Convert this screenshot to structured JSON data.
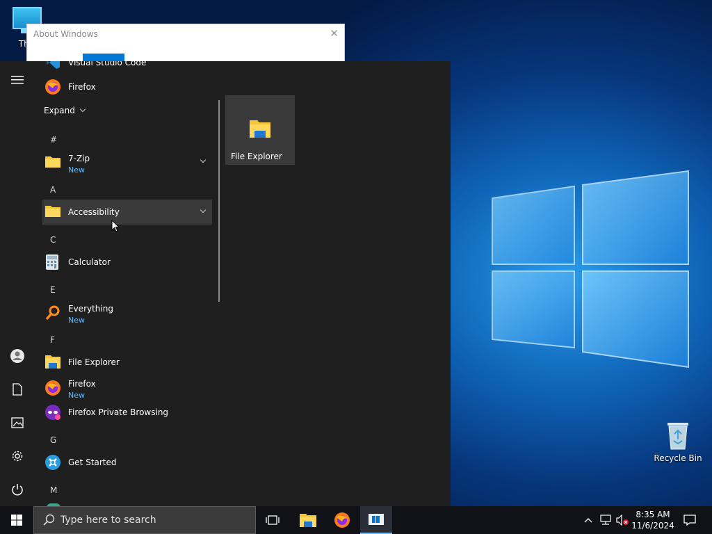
{
  "desktop": {
    "this_pc_label": "This",
    "recycle_bin_label": "Recycle Bin"
  },
  "about_window": {
    "title": "About Windows",
    "close_glyph": "✕"
  },
  "start_menu": {
    "top_partial": "Visual Studio Code",
    "recent": [
      {
        "label": "Firefox"
      }
    ],
    "expand_label": "Expand",
    "groups": {
      "hash": "#",
      "a": "A",
      "c": "C",
      "e": "E",
      "f": "F",
      "g": "G",
      "m": "M"
    },
    "apps": {
      "sevenzip": {
        "label": "7-Zip",
        "badge": "New"
      },
      "accessibility": {
        "label": "Accessibility"
      },
      "calculator": {
        "label": "Calculator"
      },
      "everything": {
        "label": "Everything",
        "badge": "New"
      },
      "file_explorer": {
        "label": "File Explorer"
      },
      "firefox": {
        "label": "Firefox",
        "badge": "New"
      },
      "firefox_private": {
        "label": "Firefox Private Browsing"
      },
      "get_started": {
        "label": "Get Started"
      }
    },
    "tile": {
      "label": "File Explorer"
    }
  },
  "taskbar": {
    "search_placeholder": "Type here to search",
    "time": "8:35 AM",
    "date": "11/6/2024"
  },
  "colors": {
    "accent": "#0078d7",
    "new_badge": "#66b8ff",
    "folder": "#f8c53a"
  }
}
